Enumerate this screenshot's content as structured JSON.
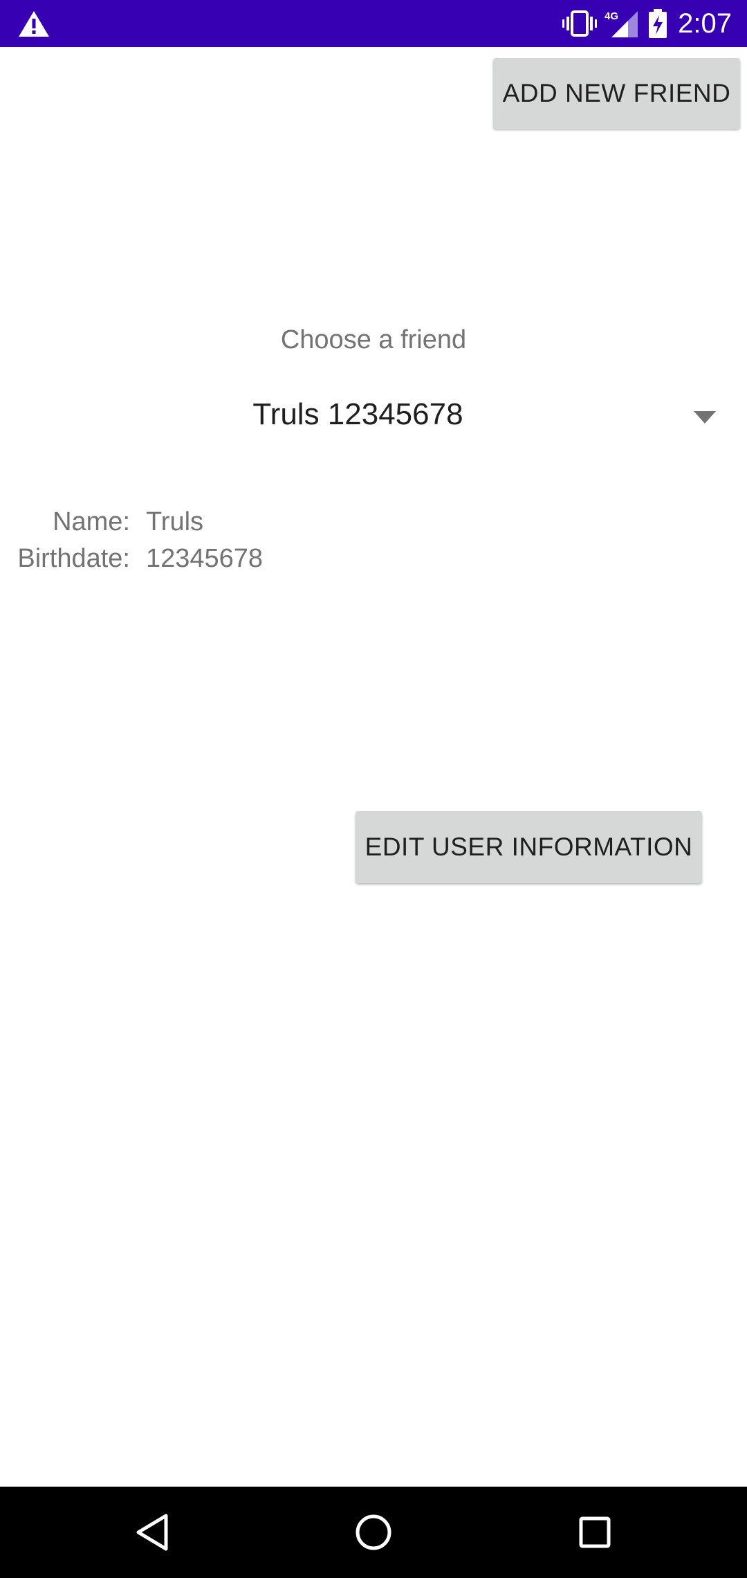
{
  "status_bar": {
    "time": "2:07",
    "network": "4G",
    "icons": [
      "warning-icon",
      "vibrate-icon",
      "signal-4g-icon",
      "battery-charging-icon"
    ]
  },
  "toolbar": {
    "add_friend_label": "ADD NEW FRIEND"
  },
  "friend_picker": {
    "prompt": "Choose a friend",
    "selected": "Truls 12345678"
  },
  "friend_info": {
    "name_label": "Name:",
    "name_value": "Truls",
    "birthdate_label": "Birthdate:",
    "birthdate_value": "12345678"
  },
  "actions": {
    "edit_label": "EDIT USER INFORMATION"
  },
  "nav_bar": {
    "icons": [
      "back-icon",
      "home-icon",
      "recents-icon"
    ]
  },
  "colors": {
    "status_bar": "#3700b3",
    "button_bg": "#d6d7d7",
    "secondary_text": "#737373",
    "primary_text": "#1f1f1f"
  }
}
